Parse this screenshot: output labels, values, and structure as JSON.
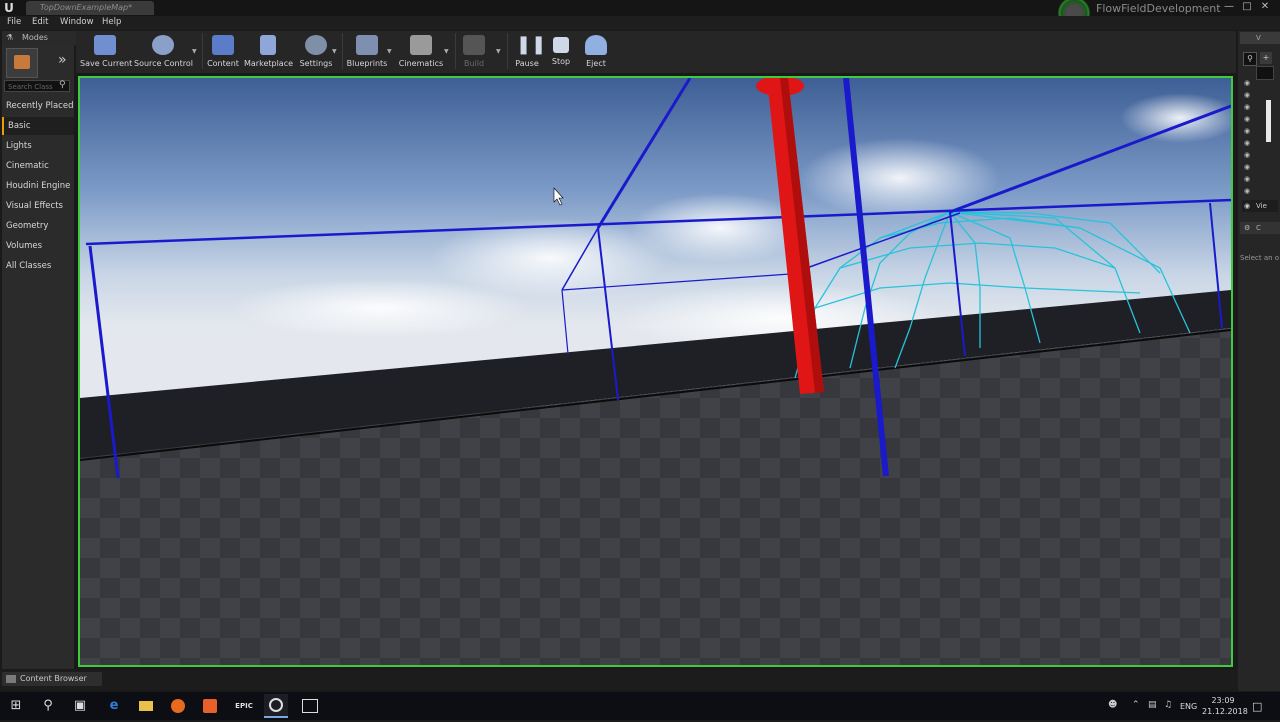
{
  "window": {
    "tab_title": "TopDownExampleMap*",
    "project_name": "FlowFieldDevelopment",
    "logo_icon": "unreal-logo",
    "controls": [
      "minimize",
      "maximize",
      "close"
    ]
  },
  "menu": [
    "File",
    "Edit",
    "Window",
    "Help"
  ],
  "modes": {
    "tab_label": "Modes",
    "search_placeholder": "Search Class",
    "categories": [
      "Recently Placed",
      "Basic",
      "Lights",
      "Cinematic",
      "Houdini Engine",
      "Visual Effects",
      "Geometry",
      "Volumes",
      "All Classes"
    ],
    "selected": "Basic"
  },
  "toolbar": {
    "items": [
      {
        "label": "Save Current",
        "icon": "save-icon",
        "color": "#6f8fd0"
      },
      {
        "label": "Source Control",
        "icon": "source-control-icon",
        "color": "#8aa0c8"
      },
      {
        "label": "Content",
        "icon": "content-icon",
        "color": "#5b7cc8"
      },
      {
        "label": "Marketplace",
        "icon": "marketplace-icon",
        "color": "#8fa7d8"
      },
      {
        "label": "Settings",
        "icon": "settings-icon",
        "color": "#7f8fa8"
      },
      {
        "label": "Blueprints",
        "icon": "blueprints-icon",
        "color": "#7f8faf"
      },
      {
        "label": "Cinematics",
        "icon": "cinematics-icon",
        "color": "#9a9a9a"
      },
      {
        "label": "Build",
        "icon": "build-icon",
        "color": "#555555"
      },
      {
        "label": "Pause",
        "icon": "pause-icon",
        "color": "#cfd8e8"
      },
      {
        "label": "Stop",
        "icon": "stop-icon",
        "color": "#cfd8e8"
      },
      {
        "label": "Eject",
        "icon": "eject-icon",
        "color": "#8fb0e0"
      }
    ]
  },
  "outliner": {
    "tab_label": "V",
    "view_options": "Vie"
  },
  "details": {
    "tab_label": "C",
    "empty_message": "Select an o"
  },
  "content_browser": {
    "tab_label": "Content Browser"
  },
  "taskbar": {
    "apps": [
      "windows-start-icon",
      "search-icon",
      "task-view-icon",
      "edge-icon",
      "file-explorer-icon",
      "firefox-icon",
      "houdini-icon",
      "epic-launcher-icon",
      "unreal-editor-icon",
      "terminal-icon"
    ],
    "language": "ENG",
    "time": "23:09",
    "date": "21.12.2018"
  },
  "colors": {
    "viewport_border": "#3ecb3e",
    "volume_lines": "#1a1acc",
    "dome_lines": "#27c3d9",
    "pillar": "#e01515",
    "accent_selected": "#e8a000"
  }
}
